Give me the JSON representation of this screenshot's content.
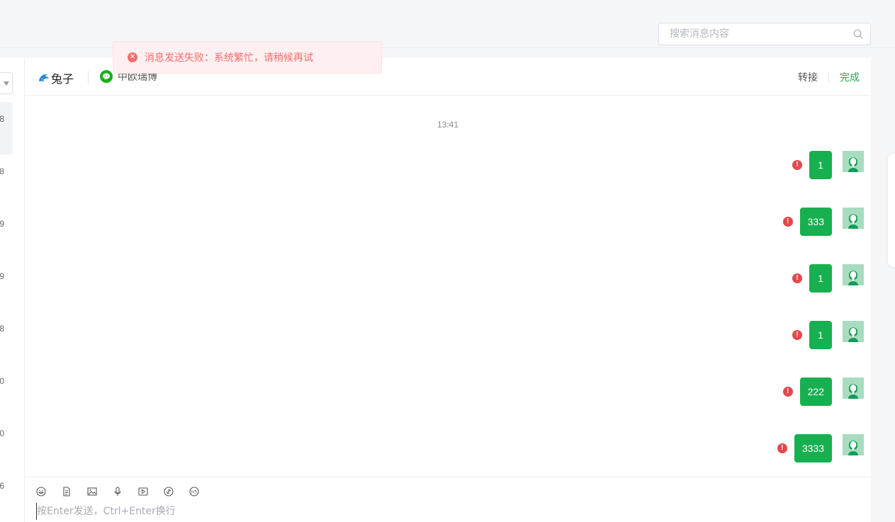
{
  "search": {
    "placeholder": "搜索消息内容"
  },
  "toast": {
    "message": "消息发送失败：系统繁忙，请稍候再试",
    "icon": "close-circle-icon",
    "color": "#f56c6c"
  },
  "sidebar": {
    "items": [
      {
        "time_fragment": "8"
      },
      {
        "time_fragment": "8"
      },
      {
        "time_fragment": "9"
      },
      {
        "time_fragment": "9"
      },
      {
        "time_fragment": "8"
      },
      {
        "time_fragment": "0"
      },
      {
        "time_fragment": "0"
      },
      {
        "time_fragment": "6"
      }
    ]
  },
  "chat": {
    "contact_icon": "dolphin-icon",
    "contact_name": "兔子",
    "channel_icon": "wechat-icon",
    "channel_name": "中欧瑞博",
    "transfer_label": "转接",
    "done_label": "完成",
    "accent_color": "#1aad4c",
    "timestamp": "13:41",
    "messages": [
      {
        "text": "1",
        "status": "failed"
      },
      {
        "text": "333",
        "status": "failed"
      },
      {
        "text": "1",
        "status": "failed"
      },
      {
        "text": "1",
        "status": "failed"
      },
      {
        "text": "222",
        "status": "failed"
      },
      {
        "text": "3333",
        "status": "failed"
      }
    ],
    "error_mark": "!"
  },
  "composer": {
    "tools": [
      "emoji-icon",
      "file-icon",
      "image-icon",
      "microphone-icon",
      "video-icon",
      "link-icon",
      "h5-icon"
    ],
    "placeholder": "按Enter发送，Ctrl+Enter换行"
  }
}
